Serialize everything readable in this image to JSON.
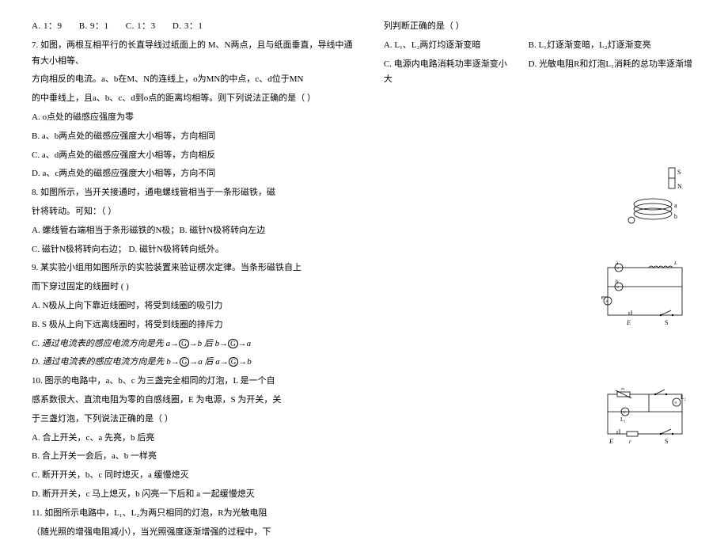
{
  "q6_options": {
    "a": "A.  1：9",
    "b": "B.  9：1",
    "c": "C.  1：3",
    "d": "D.  3：1"
  },
  "q7_line1": "7. 如图，两根互相平行的长直导线过纸面上的 M、N两点，且与纸面垂直，导线中通有大小相等、",
  "q7_line2": "方向相反的电流。a、b在M、N的连线上，o为MN的中点，c、d位于MN",
  "q7_line3": "的中垂线上，且a、b、c、d到o点的距离均相等。则下列说法正确的是（      ）",
  "q7_optA": "A.  o点处的磁感应强度为零",
  "q7_optB": "B.  a、b两点处的磁感应强度大小相等，方向相同",
  "q7_optC": "C.  a、d两点处的磁感应强度大小相等，方向相反",
  "q7_optD": "D.  a、c两点处的磁感应强度大小相等，方向不同",
  "q8_line1": "8. 如图所示，当开关接通时，通电螺线管相当于一条形磁铁，磁",
  "q8_line2": "针将转动。可知：（    ）",
  "q8_optAB": "A.  螺线管右端相当于条形磁铁的N极；B.  磁针N极将转向左边",
  "q8_optCD": "C.  磁针N极将转向右边；    D.  磁针N极将转向纸外。",
  "q9_line1": "9. 某实验小组用如图所示的实验装置来验证楞次定律。当条形磁铁自上",
  "q9_line2": "而下穿过固定的线圈时 (   )",
  "q9_optA": "A.  N极从上向下靠近线圈时，将受到线圈的吸引力",
  "q9_optB": "B.  S 极从上向下远离线圈时，将受到线圈的排斥力",
  "q9_optC_pre": "C.  通过电流表的感应电流方向是先 a→",
  "q9_optC_mid": "→b 后 b→",
  "q9_optC_end": "→a",
  "q9_optD_pre": "D.  通过电流表的感应电流方向是先 b→",
  "q9_optD_mid": "→a 后 a→",
  "q9_optD_end": "→b",
  "q10_line1": "10. 图示的电路中，a、b、c 为三盏完全相同的灯泡，L 是一个自",
  "q10_line2": "感系数很大、直流电阻为零的自感线圈，E 为电源，S 为开关，关",
  "q10_line3": "于三盏灯泡，下列说法正确的是（ ）",
  "q10_optA": "A.  合上开关，c、a 先亮，b 后亮",
  "q10_optB": "B.  合上开关一会后，a、b 一样亮",
  "q10_optC": "C.  断开开关，b、c 同时熄灭，a 缓慢熄灭",
  "q10_optD": "D.  断开开关，c 马上熄灭，b 闪亮一下后和 a 一起缓慢熄灭",
  "q11_line1": "11. 如图所示电路中，L₁、L₂为两只相同的灯泡，R为光敏电阻",
  "q11_line2": "（随光照的增强电阻减小），当光照强度逐渐增强的过程中，下",
  "r_line1": "列判断正确的是（    ）",
  "r_optA": "A.  L₁、L₂两灯均逐渐变暗",
  "r_optB": "B.  L₁灯逐渐变暗，L₂灯逐渐变亮",
  "r_optC": "C.  电源内电路消耗功率逐渐变小",
  "r_optD": "D.  光敏电阻R和灯泡L₁消耗的总功率逐渐增大",
  "circled_g": "G"
}
